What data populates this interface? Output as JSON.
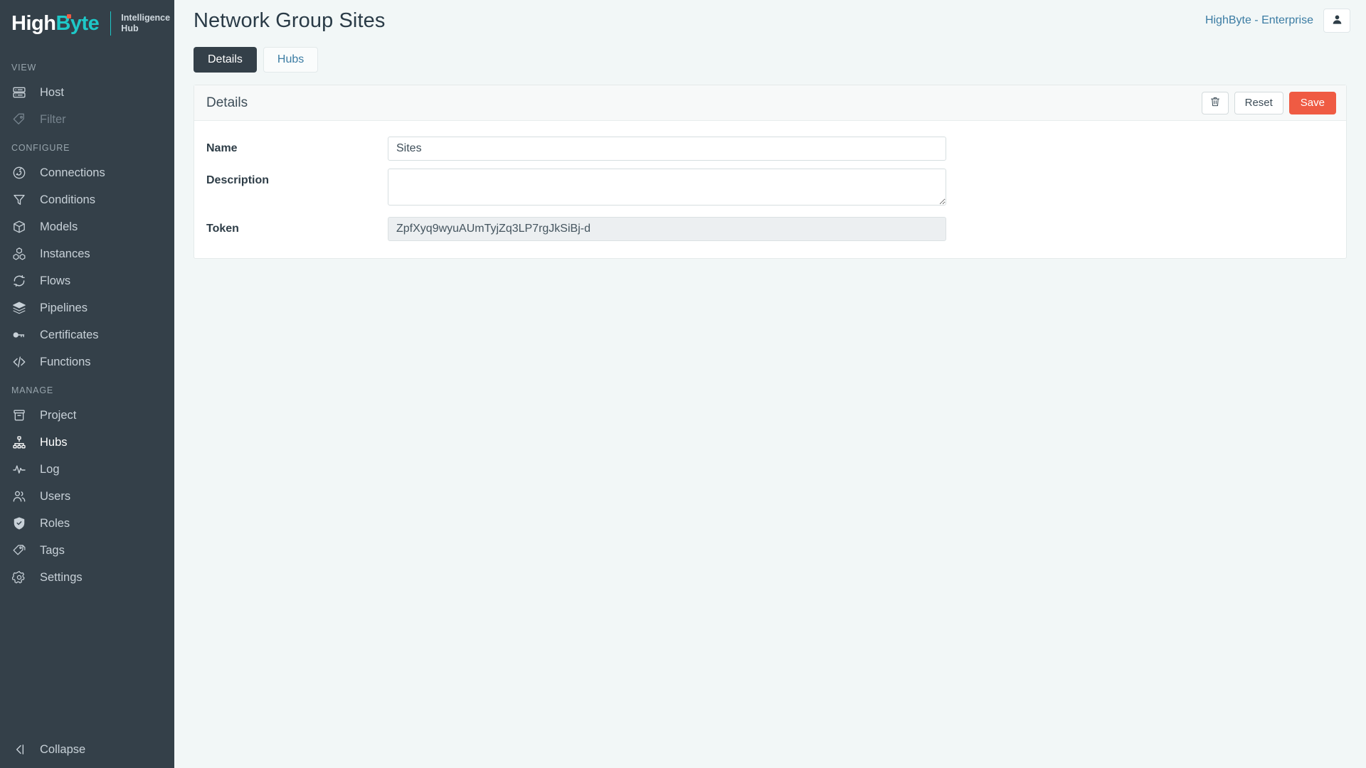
{
  "brand": {
    "logo_high": "High",
    "logo_byte": "Byte",
    "sub_line1": "Intelligence",
    "sub_line2": "Hub"
  },
  "sidebar": {
    "sections": [
      {
        "label": "VIEW",
        "items": [
          {
            "label": "Host",
            "icon": "server-icon",
            "state": "normal"
          },
          {
            "label": "Filter",
            "icon": "tag-icon",
            "state": "disabled"
          }
        ]
      },
      {
        "label": "CONFIGURE",
        "items": [
          {
            "label": "Connections",
            "icon": "plug-circle-icon",
            "state": "normal"
          },
          {
            "label": "Conditions",
            "icon": "funnel-icon",
            "state": "normal"
          },
          {
            "label": "Models",
            "icon": "box-icon",
            "state": "normal"
          },
          {
            "label": "Instances",
            "icon": "cubes-icon",
            "state": "normal"
          },
          {
            "label": "Flows",
            "icon": "sync-icon",
            "state": "normal"
          },
          {
            "label": "Pipelines",
            "icon": "layers-icon",
            "state": "normal"
          },
          {
            "label": "Certificates",
            "icon": "key-icon",
            "state": "normal"
          },
          {
            "label": "Functions",
            "icon": "code-icon",
            "state": "normal"
          }
        ]
      },
      {
        "label": "MANAGE",
        "items": [
          {
            "label": "Project",
            "icon": "archive-icon",
            "state": "normal"
          },
          {
            "label": "Hubs",
            "icon": "sitemap-icon",
            "state": "active"
          },
          {
            "label": "Log",
            "icon": "pulse-icon",
            "state": "normal"
          },
          {
            "label": "Users",
            "icon": "users-icon",
            "state": "normal"
          },
          {
            "label": "Roles",
            "icon": "shield-check-icon",
            "state": "normal"
          },
          {
            "label": "Tags",
            "icon": "tags-icon",
            "state": "normal"
          },
          {
            "label": "Settings",
            "icon": "gear-icon",
            "state": "normal"
          }
        ]
      }
    ],
    "collapse_label": "Collapse",
    "collapse_icon": "arrow-left-to-bar-icon"
  },
  "header": {
    "title": "Network Group Sites",
    "tenant": "HighByte - Enterprise",
    "avatar_icon": "user-icon"
  },
  "tabs": [
    {
      "label": "Details",
      "active": true
    },
    {
      "label": "Hubs",
      "active": false
    }
  ],
  "card": {
    "title": "Details",
    "actions": {
      "delete_icon": "trash-icon",
      "reset_label": "Reset",
      "save_label": "Save"
    },
    "fields": [
      {
        "label": "Name",
        "type": "text",
        "value": "Sites",
        "placeholder": "",
        "disabled": false
      },
      {
        "label": "Description",
        "type": "textarea",
        "value": "",
        "placeholder": "",
        "disabled": false
      },
      {
        "label": "Token",
        "type": "text",
        "value": "ZpfXyq9wyuAUmTyjZq3LP7rgJkSiBj-d",
        "placeholder": "",
        "disabled": true
      }
    ]
  },
  "colors": {
    "sidebar_bg": "#344049",
    "accent_teal": "#1ec8c8",
    "accent_orange": "#ef5b43",
    "link_blue": "#3b7ca3",
    "page_bg": "#f2f7f7"
  }
}
